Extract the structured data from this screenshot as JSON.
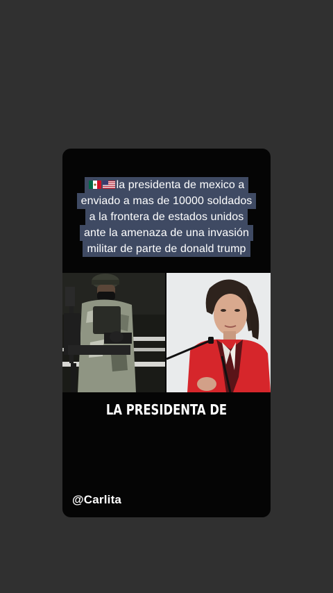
{
  "caption": {
    "flags": [
      "mexico-flag",
      "usa-flag"
    ],
    "lines": [
      "la presidenta  de mexico a",
      "enviado a mas de 10000 soldados",
      "a la frontera de estados unidos",
      "ante la amenaza de una invasión",
      "militar de parte de donald trump"
    ]
  },
  "images": {
    "left": "soldier-with-machine-gun-photo",
    "right": "president-speaking-at-microphone-photo"
  },
  "subtitle": "LA PRESIDENTA DE",
  "watermark": "@Carlita",
  "colors": {
    "background": "#303030",
    "card": "#050505",
    "caption_bg": "#3f4a63",
    "text": "#ffffff",
    "jacket_red": "#d6262b"
  }
}
